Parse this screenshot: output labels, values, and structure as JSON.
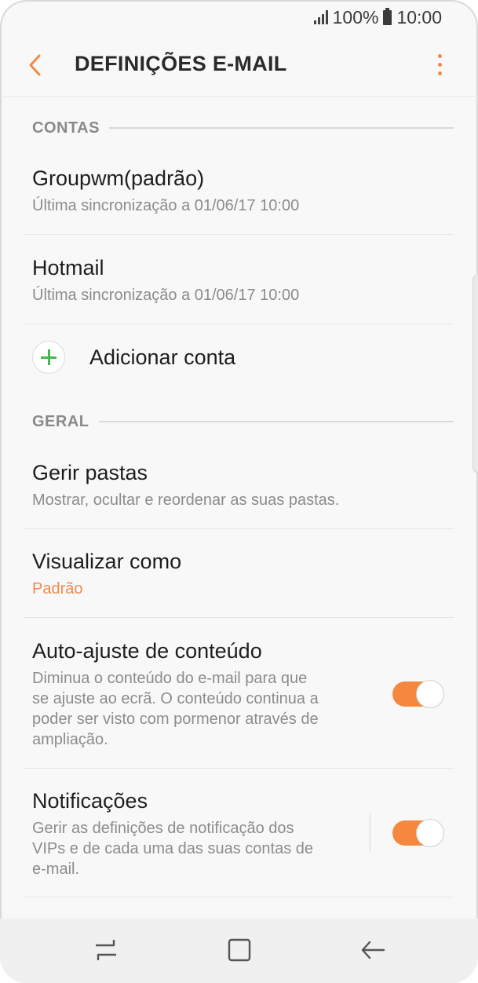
{
  "status_bar": {
    "battery": "100%",
    "time": "10:00",
    "icons": [
      "signal-icon",
      "battery-icon"
    ]
  },
  "app_bar": {
    "title": "DEFINIÇÕES E-MAIL",
    "back_icon": "back-arrow-icon",
    "menu_icon": "more-vert-icon"
  },
  "sections": {
    "accounts": "CONTAS",
    "general": "GERAL"
  },
  "accounts": [
    {
      "name": "Groupwm(padrão)",
      "sync": "Última sincronização a 01/06/17  10:00"
    },
    {
      "name": "Hotmail",
      "sync": "Última sincronização a 01/06/17  10:00"
    }
  ],
  "add_account": {
    "label": "Adicionar conta",
    "icon": "plus-icon"
  },
  "general_items": {
    "folders": {
      "title": "Gerir pastas",
      "subtitle": "Mostrar, ocultar e reordenar as suas pastas."
    },
    "view_as": {
      "title": "Visualizar como",
      "value": "Padrão"
    },
    "auto_fit": {
      "title": "Auto-ajuste de conteúdo",
      "subtitle_lines": [
        "Diminua o conteúdo do e-mail para que",
        "se ajuste ao ecrã. O conteúdo continua a",
        "poder ser visto com pormenor através de",
        "ampliação."
      ],
      "enabled": true
    },
    "notifications": {
      "title": "Notificações",
      "subtitle_lines": [
        "Gerir as definições de notificação dos",
        "VIPs e de cada uma das suas contas de",
        "e-mail."
      ],
      "enabled": true
    }
  },
  "nav_bar": {
    "icons": [
      "recents-icon",
      "home-icon",
      "back-icon"
    ]
  },
  "colors": {
    "accent": "#f08a4b",
    "toggle_on": "#f5883e",
    "plus_green": "#47b84f"
  }
}
